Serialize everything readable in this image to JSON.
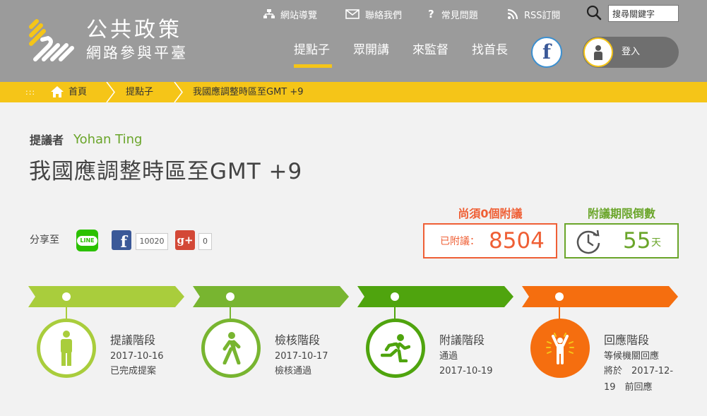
{
  "header": {
    "logo_line1": "公共政策",
    "logo_line2": "網路參與平臺",
    "util_links": [
      "網站導覽",
      "聯絡我們",
      "常見問題",
      "RSS訂閱"
    ],
    "util_qmark": "?",
    "search_value": "搜尋關鍵字",
    "nav": [
      "提點子",
      "眾開講",
      "來監督",
      "找首長"
    ],
    "fb_glyph": "f",
    "login_label": "登入"
  },
  "breadcrumb": {
    "dots": ":::",
    "items": [
      "首頁",
      "提點子",
      "我國應調整時區至GMT +9"
    ]
  },
  "proposal": {
    "proposer_label": "提議者",
    "proposer_name": "Yohan Ting",
    "title": "我國應調整時區至GMT +9"
  },
  "share": {
    "label": "分享至",
    "line_text": "LINE",
    "fb_glyph": "f",
    "fb_count": "10020",
    "gplus_glyph": "g+",
    "gplus_count": "0"
  },
  "stats": {
    "need_label": "尚須0個附議",
    "attached_label": "已附議：",
    "attached_value": "8504",
    "countdown_label": "附議期限倒數",
    "days_value": "55",
    "days_unit": "天"
  },
  "timeline": [
    {
      "name": "提議階段",
      "lines": [
        "2017-10-16",
        "已完成提案"
      ],
      "color": "#a9cd3c",
      "fill": false
    },
    {
      "name": "檢核階段",
      "lines": [
        "2017-10-17",
        "檢核通過"
      ],
      "color": "#78b530",
      "fill": false
    },
    {
      "name": "附議階段",
      "lines": [
        "通過",
        "2017-10-19"
      ],
      "color": "#4fa40e",
      "fill": false
    },
    {
      "name": "回應階段",
      "lines": [
        "等候機關回應",
        "將於　2017-12-",
        "19　前回應"
      ],
      "color": "#f56e0f",
      "fill": true
    }
  ]
}
